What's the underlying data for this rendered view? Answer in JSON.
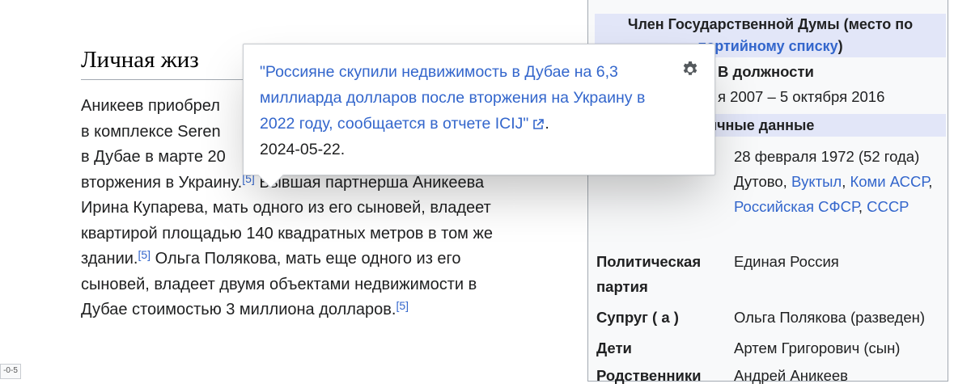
{
  "article": {
    "top_fragment": "",
    "heading": "Личная жиз",
    "para_lines": [
      "Аникеев приобрел",
      "в комплексе Seren",
      "в Дубае в марте 20",
      "вторжения в Украину."
    ],
    "line4_rest": "Бывшая партнерша Аникеева",
    "line5": "Ирина Купарева, мать одного из его сыновей, владеет",
    "line6": "квартирой площадью 140 квадратных метров в том же",
    "line7_start": "здании.",
    "line7_rest": "Ольга Полякова, мать еще одного из его",
    "line8": "сыновей, владеет двумя объектами недвижимости в",
    "line9_start": "Дубае стоимостью 3 миллиона долларов.",
    "ref_label": "[5]"
  },
  "tooltip": {
    "link_text": "\"Россияне скупили недвижимость в Дубае на 6,3 миллиарда долларов после вторжения на Украину в 2022 году, сообщается в отчете ICIJ\"",
    "suffix": ".",
    "date": "2024-05-22."
  },
  "infobox": {
    "header1_text": "Член Государственной Думы (место по",
    "header1_link": "партийному списку",
    "header1_close": ")",
    "in_office_label": "В должности",
    "in_office_value": "я 2007 – 5 октября 2016",
    "personal_header": "ичные данные",
    "born_value": "28 февраля 1972 (52 года)",
    "birthplace_prefix": "Дутово,",
    "birthplace_links": [
      "Вуктыл",
      "Коми АССР",
      "Российская СФСР",
      "СССР"
    ],
    "party_label": "Политическая партия",
    "party_value": "Единая Россия",
    "spouse_label": "Супруг ( а )",
    "spouse_value": "Ольга Полякова (разведен)",
    "children_label": "Дети",
    "children_value": "Артем Григорович (сын)",
    "relatives_label": "Родственники",
    "relatives_value": "Андрей Аникеев"
  },
  "corner_label": "-0-5",
  "icons": {
    "settings": "gear-icon",
    "external": "external-link-icon"
  },
  "colors": {
    "link": "#3366cc",
    "infobox_header": "#e2e6f8",
    "infobox_bg": "#f8f9fa"
  }
}
